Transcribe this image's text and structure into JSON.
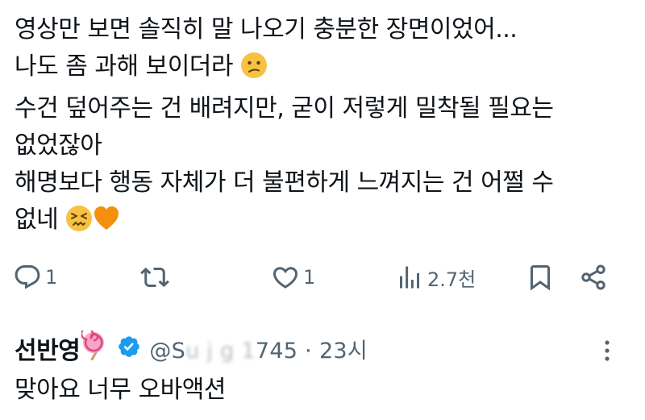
{
  "tweet": {
    "lines": [
      "영상만 보면 솔직히 말 나오기 충분한 장면이었어...",
      "나도 좀 과해 보이더라",
      "수건 덮어주는 건 배려지만, 굳이 저렇게 밀착될 필요는",
      "없었잖아",
      "해명보다 행동 자체가 더 불편하게 느껴지는 건 어쩔 수",
      "없네"
    ],
    "emojis": [
      "confused-face",
      "confounded-face",
      "orange-heart"
    ]
  },
  "actions": {
    "reply_count": "1",
    "retweet_count": "",
    "like_count": "1",
    "views_count": "2.7천"
  },
  "reply": {
    "name": "선반영",
    "name_emoji": "lollipop",
    "verified": true,
    "handle_prefix": "@S",
    "handle_obscured": "u j   g  1",
    "handle_suffix": "745",
    "separator": "·",
    "time": "23시",
    "text": "맞아요  너무 오바액션"
  },
  "colors": {
    "text": "#0f1419",
    "secondary": "#536471",
    "verified": "#1d9bf0",
    "emoji_yellow": "#f7c242",
    "heart_orange": "#f4900c"
  }
}
